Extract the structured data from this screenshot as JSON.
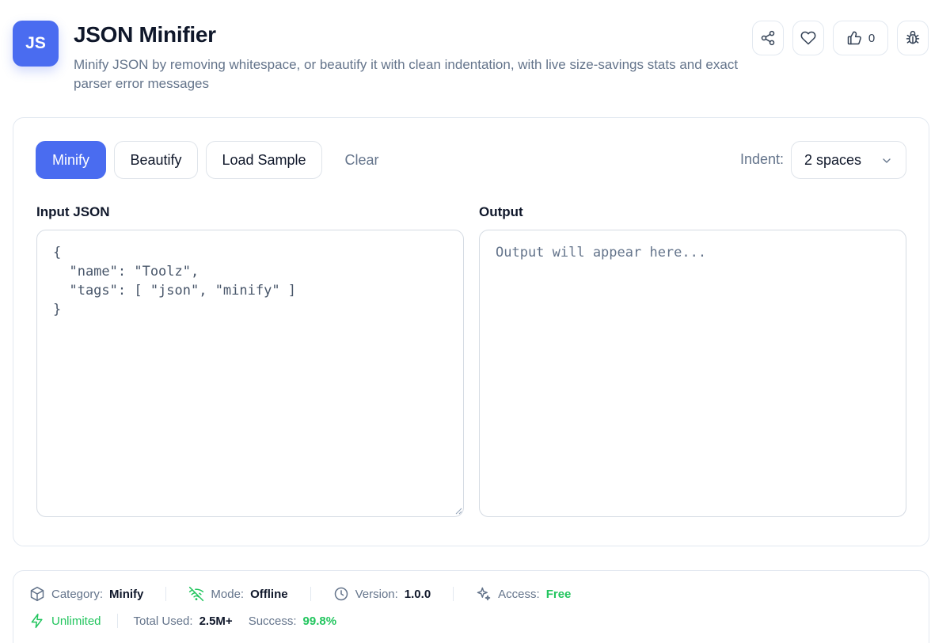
{
  "header": {
    "logo_text": "JS",
    "title": "JSON Minifier",
    "subtitle": "Minify JSON by removing whitespace, or beautify it with clean indentation, with live size-savings stats and exact parser error messages",
    "like_count": "0",
    "icons": [
      "share-icon",
      "heart-icon",
      "thumbs-up-icon",
      "bug-icon"
    ]
  },
  "toolbar": {
    "minify_label": "Minify",
    "beautify_label": "Beautify",
    "load_sample_label": "Load Sample",
    "clear_label": "Clear",
    "indent_label": "Indent:",
    "indent_value": "2 spaces"
  },
  "input": {
    "label": "Input JSON",
    "value": "{\n  \"name\": \"Toolz\",\n  \"tags\": [ \"json\", \"minify\" ]\n}"
  },
  "output": {
    "label": "Output",
    "placeholder": "Output will appear here...",
    "value": ""
  },
  "footer": {
    "category_label": "Category:",
    "category_value": "Minify",
    "mode_label": "Mode:",
    "mode_value": "Offline",
    "version_label": "Version:",
    "version_value": "1.0.0",
    "access_label": "Access:",
    "access_value": "Free",
    "unlimited_label": "Unlimited",
    "total_used_label": "Total Used:",
    "total_used_value": "2.5M+",
    "success_label": "Success:",
    "success_value": "99.8%"
  },
  "colors": {
    "accent": "#4a6cf0",
    "success": "#22c55e",
    "muted_text": "#64748b",
    "border": "#e2e8f0"
  }
}
